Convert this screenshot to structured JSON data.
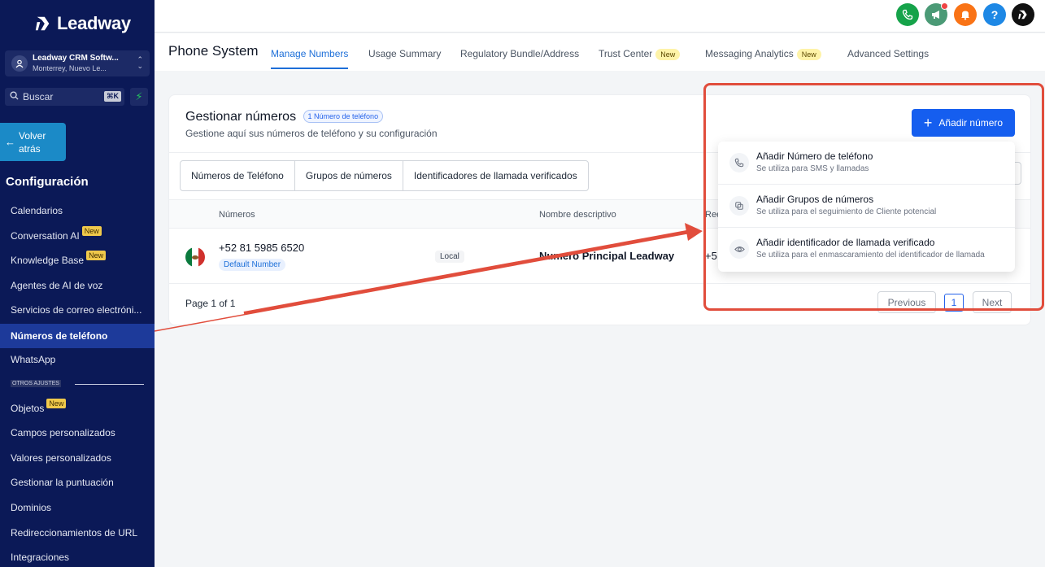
{
  "brand": {
    "name": "Leadway"
  },
  "account": {
    "name": "Leadway CRM Softw...",
    "location": "Monterrey, Nuevo Le..."
  },
  "search": {
    "placeholder": "Buscar",
    "shortcut": "⌘K"
  },
  "back_button": {
    "label_line1": "Volver",
    "label_line2": "atrás"
  },
  "sidebar": {
    "section_title": "Configuración",
    "items": [
      {
        "label": "Calendarios",
        "badge": ""
      },
      {
        "label": "Conversation AI",
        "badge": "New"
      },
      {
        "label": "Knowledge Base",
        "badge": "New"
      },
      {
        "label": "Agentes de AI de voz",
        "badge": ""
      },
      {
        "label": "Servicios de correo electróni...",
        "badge": ""
      },
      {
        "label": "Números de teléfono",
        "badge": "",
        "active": true
      },
      {
        "label": "WhatsApp",
        "badge": ""
      }
    ],
    "other_settings_label": "OTROS AJUSTES",
    "other_items": [
      {
        "label": "Objetos",
        "badge": "New"
      },
      {
        "label": "Campos personalizados",
        "badge": ""
      },
      {
        "label": "Valores personalizados",
        "badge": ""
      },
      {
        "label": "Gestionar la puntuación",
        "badge": ""
      },
      {
        "label": "Dominios",
        "badge": ""
      },
      {
        "label": "Redireccionamientos de URL",
        "badge": ""
      },
      {
        "label": "Integraciones",
        "badge": ""
      }
    ]
  },
  "topbar": {
    "icons": [
      {
        "name": "phone-icon",
        "color": "#16a34a"
      },
      {
        "name": "megaphone-icon",
        "color": "#4b9a76"
      },
      {
        "name": "bell-icon",
        "color": "#f97316"
      },
      {
        "name": "help-icon",
        "color": "#1e88e5"
      },
      {
        "name": "leadway-icon",
        "color": "#111111"
      }
    ]
  },
  "page": {
    "title": "Phone System",
    "tabs": [
      {
        "label": "Manage Numbers",
        "active": true,
        "badge": ""
      },
      {
        "label": "Usage Summary",
        "badge": ""
      },
      {
        "label": "Regulatory Bundle/Address",
        "badge": ""
      },
      {
        "label": "Trust Center",
        "badge": "New"
      },
      {
        "label": "Messaging Analytics",
        "badge": "New"
      },
      {
        "label": "Advanced Settings",
        "badge": ""
      }
    ]
  },
  "card": {
    "title": "Gestionar números",
    "count_pill": "1 Número de teléfono",
    "subtitle": "Gestione aquí sus números de teléfono y su configuración",
    "segments": [
      "Números de Teléfono",
      "Grupos de números",
      "Identificadores de llamada verificados"
    ],
    "columns": {
      "numbers": "Números",
      "friendly_name": "Nombre descriptivo",
      "forward": "Ree"
    },
    "rows": [
      {
        "phone": "+52 81 5985 6520",
        "default_badge": "Default Number",
        "type": "Local",
        "friendly_name": "Numero Principal Leadway",
        "forward": "+5"
      }
    ],
    "pagination": {
      "info": "Page 1 of 1",
      "previous": "Previous",
      "current": "1",
      "next": "Next"
    }
  },
  "add_button": {
    "label": "Añadir número"
  },
  "dropdown": {
    "items": [
      {
        "title": "Añadir Número de teléfono",
        "subtitle": "Se utiliza para SMS y llamadas",
        "icon": "phone-plus-icon"
      },
      {
        "title": "Añadir Grupos de números",
        "subtitle": "Se utiliza para el seguimiento de Cliente potencial",
        "icon": "group-icon"
      },
      {
        "title": "Añadir identificador de llamada verificado",
        "subtitle": "Se utiliza para el enmascaramiento del identificador de llamada",
        "icon": "eye-icon"
      }
    ]
  },
  "annotation": {
    "box_color": "#e14d3c"
  }
}
